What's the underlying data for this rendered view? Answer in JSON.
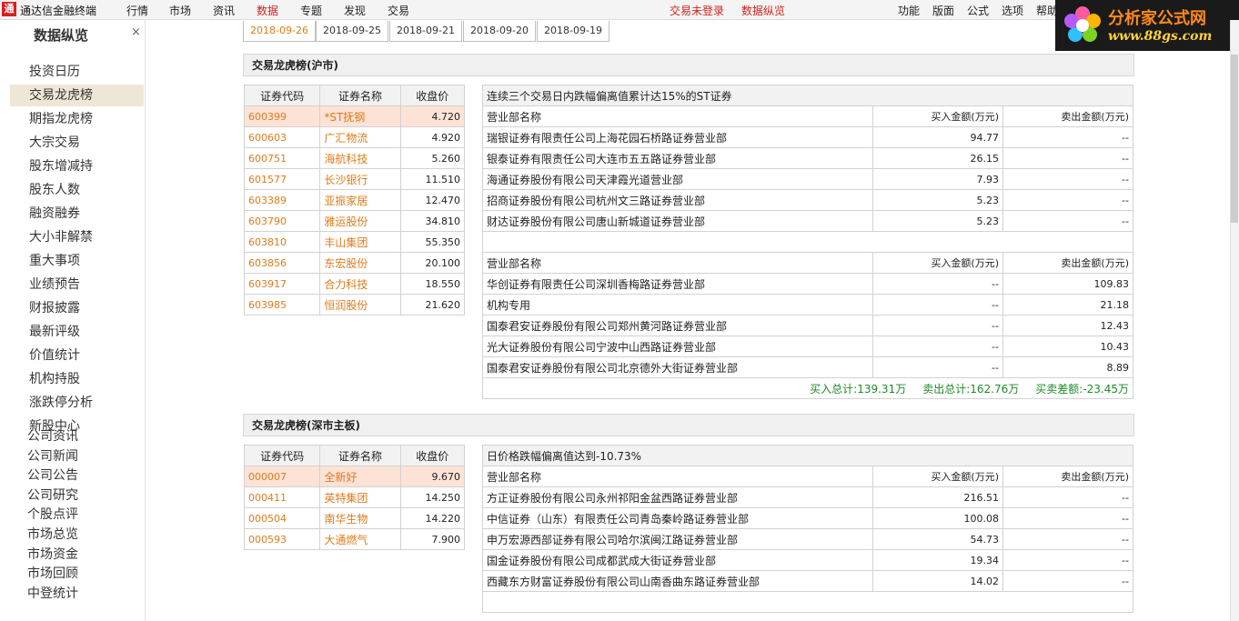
{
  "app": {
    "title": "通达信金融终端",
    "logo_glyph": "通"
  },
  "menu": {
    "items": [
      "行情",
      "市场",
      "资讯",
      "数据",
      "专题",
      "发现",
      "交易"
    ],
    "active_index": 3,
    "status_login": "交易未登录",
    "status_data": "数据纵览",
    "right_items": [
      "功能",
      "版面",
      "公式",
      "选项",
      "帮助"
    ]
  },
  "brand": {
    "name": "分析家公式网",
    "url": "www.88gs.com"
  },
  "sidebar": {
    "title": "数据纵览",
    "close": "×",
    "items": [
      {
        "label": "投资日历"
      },
      {
        "label": "交易龙虎榜"
      },
      {
        "label": "期指龙虎榜"
      },
      {
        "label": "大宗交易"
      },
      {
        "label": "股东增减持"
      },
      {
        "label": "股东人数"
      },
      {
        "label": "融资融券"
      },
      {
        "label": "大小非解禁"
      },
      {
        "label": "重大事项"
      },
      {
        "label": "业绩预告"
      },
      {
        "label": "财报披露"
      },
      {
        "label": "最新评级"
      },
      {
        "label": "价值统计"
      },
      {
        "label": "机构持股"
      },
      {
        "label": "涨跌停分析"
      },
      {
        "label": "新股中心"
      }
    ],
    "active_index": 1,
    "flat_items": [
      "公司资讯",
      "公司新闻",
      "公司公告",
      "公司研究",
      "个股点评",
      "市场总览",
      "市场资金",
      "市场回顾",
      "中登统计"
    ]
  },
  "dates": [
    "2018-09-26",
    "2018-09-25",
    "2018-09-21",
    "2018-09-20",
    "2018-09-19"
  ],
  "active_date_index": 0,
  "sh": {
    "title": "交易龙虎榜(沪市)",
    "headers": [
      "证券代码",
      "证券名称",
      "收盘价"
    ],
    "rows": [
      {
        "code": "600399",
        "name": "*ST抚钢",
        "price": "4.720"
      },
      {
        "code": "600603",
        "name": "广汇物流",
        "price": "4.920"
      },
      {
        "code": "600751",
        "name": "海航科技",
        "price": "5.260"
      },
      {
        "code": "601577",
        "name": "长沙银行",
        "price": "11.510"
      },
      {
        "code": "603389",
        "name": "亚振家居",
        "price": "12.470"
      },
      {
        "code": "603790",
        "name": "雅运股份",
        "price": "34.810"
      },
      {
        "code": "603810",
        "name": "丰山集团",
        "price": "55.350"
      },
      {
        "code": "603856",
        "name": "东宏股份",
        "price": "20.100"
      },
      {
        "code": "603917",
        "name": "合力科技",
        "price": "18.550"
      },
      {
        "code": "603985",
        "name": "恒润股份",
        "price": "21.620"
      }
    ],
    "detail": {
      "caption": "连续三个交易日内跌幅偏离值累计达15%的ST证券",
      "columns": [
        "营业部名称",
        "买入金额(万元)",
        "卖出金额(万元)"
      ],
      "buy": [
        {
          "dept": "瑞银证券有限责任公司上海花园石桥路证券营业部",
          "buy": "94.77",
          "sell": "--"
        },
        {
          "dept": "银泰证券有限责任公司大连市五五路证券营业部",
          "buy": "26.15",
          "sell": "--"
        },
        {
          "dept": "海通证券股份有限公司天津霞光道营业部",
          "buy": "7.93",
          "sell": "--"
        },
        {
          "dept": "招商证券股份有限公司杭州文三路证券营业部",
          "buy": "5.23",
          "sell": "--"
        },
        {
          "dept": "财达证券股份有限公司唐山新城道证券营业部",
          "buy": "5.23",
          "sell": "--"
        }
      ],
      "sell": [
        {
          "dept": "华创证券有限责任公司深圳香梅路证券营业部",
          "buy": "--",
          "sell": "109.83"
        },
        {
          "dept": "机构专用",
          "buy": "--",
          "sell": "21.18"
        },
        {
          "dept": "国泰君安证券股份有限公司郑州黄河路证券营业部",
          "buy": "--",
          "sell": "12.43"
        },
        {
          "dept": "光大证券股份有限公司宁波中山西路证券营业部",
          "buy": "--",
          "sell": "10.43"
        },
        {
          "dept": "国泰君安证券股份有限公司北京德外大街证券营业部",
          "buy": "--",
          "sell": "8.89"
        }
      ],
      "summary": {
        "buy_total": "买入总计:139.31万",
        "sell_total": "卖出总计:162.76万",
        "diff": "买卖差额:-23.45万"
      }
    }
  },
  "sz": {
    "title": "交易龙虎榜(深市主板)",
    "headers": [
      "证券代码",
      "证券名称",
      "收盘价"
    ],
    "rows": [
      {
        "code": "000007",
        "name": "全新好",
        "price": "9.670"
      },
      {
        "code": "000411",
        "name": "英特集团",
        "price": "14.250"
      },
      {
        "code": "000504",
        "name": "南华生物",
        "price": "14.220"
      },
      {
        "code": "000593",
        "name": "大通燃气",
        "price": "7.900"
      }
    ],
    "detail": {
      "caption": "日价格跌幅偏离值达到-10.73%",
      "columns": [
        "营业部名称",
        "买入金额(万元)",
        "卖出金额(万元)"
      ],
      "buy": [
        {
          "dept": "方正证券股份有限公司永州祁阳金盆西路证券营业部",
          "buy": "216.51",
          "sell": "--"
        },
        {
          "dept": "中信证券（山东）有限责任公司青岛秦岭路证券营业部",
          "buy": "100.08",
          "sell": "--"
        },
        {
          "dept": "申万宏源西部证券有限公司哈尔滨闽江路证券营业部",
          "buy": "54.73",
          "sell": "--"
        },
        {
          "dept": "国金证券股份有限公司成都武成大街证券营业部",
          "buy": "19.34",
          "sell": "--"
        },
        {
          "dept": "西藏东方财富证券股份有限公司山南香曲东路证券营业部",
          "buy": "14.02",
          "sell": "--"
        }
      ]
    }
  }
}
